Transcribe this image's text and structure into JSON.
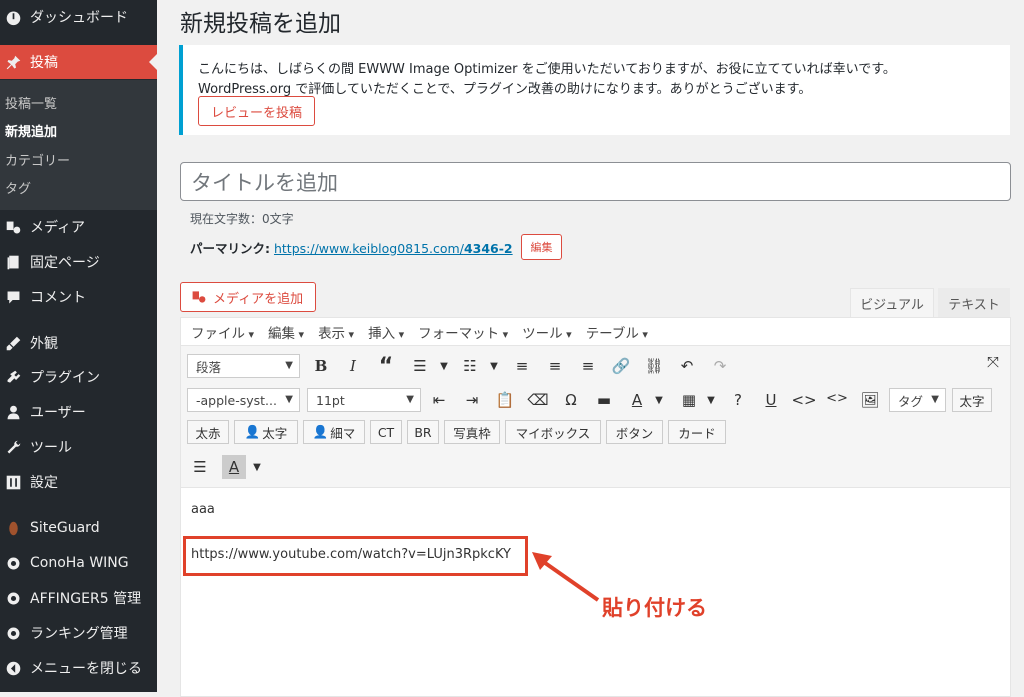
{
  "sidebar": {
    "dashboard": "ダッシュボード",
    "posts": "投稿",
    "sub": [
      "投稿一覧",
      "新規追加",
      "カテゴリー",
      "タグ"
    ],
    "media": "メディア",
    "pages": "固定ページ",
    "comments": "コメント",
    "appearance": "外観",
    "plugins": "プラグイン",
    "users": "ユーザー",
    "tools": "ツール",
    "settings": "設定",
    "siteguard": "SiteGuard",
    "conoha": "ConoHa WING",
    "affinger": "AFFINGER5 管理",
    "ranking": "ランキング管理",
    "collapse": "メニューを閉じる"
  },
  "page_title": "新規投稿を追加",
  "notice": {
    "line1": "こんにちは、しばらくの間 EWWW Image Optimizer をご使用いただいておりますが、お役に立てていれば幸いです。",
    "line2": "WordPress.org で評価していただくことで、プラグイン改善の助けになります。ありがとうございます。",
    "button": "レビューを投稿"
  },
  "title_placeholder": "タイトルを追加",
  "char_count": "現在文字数：0文字",
  "permalink": {
    "label": "パーマリンク:",
    "url_base": "https://www.keiblog0815.com/",
    "url_slug": "4346-2",
    "edit": "編集"
  },
  "add_media": "メディアを追加",
  "tabs": {
    "visual": "ビジュアル",
    "text": "テキスト"
  },
  "menubar": [
    "ファイル",
    "編集",
    "表示",
    "挿入",
    "フォーマット",
    "ツール",
    "テーブル"
  ],
  "toolbar": {
    "format": "段落",
    "font": "-apple-syst...",
    "size": "11pt",
    "tag": "タグ",
    "buttons": [
      "太字",
      "太赤",
      "太字",
      "細マ",
      "CT",
      "BR",
      "写真枠",
      "マイボックス",
      "ボタン",
      "カード"
    ]
  },
  "content": {
    "line1": "aaa",
    "line2": "https://www.youtube.com/watch?v=LUjn3RpkcKY"
  },
  "annotation": "貼り付ける",
  "colors": {
    "accent": "#dc4b3f",
    "sidebar": "#23282d",
    "link": "#0073aa",
    "annotation": "#e0412a"
  }
}
